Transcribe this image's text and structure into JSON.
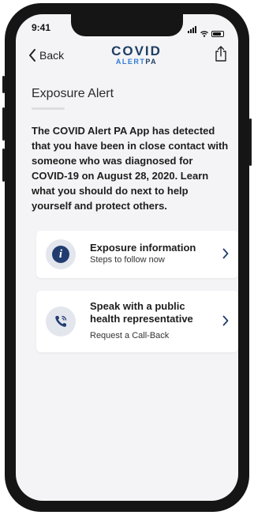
{
  "status_bar": {
    "time": "9:41"
  },
  "nav": {
    "back_label": "Back",
    "logo_top": "COVID",
    "logo_bottom_prefix": "ALERT",
    "logo_bottom_suffix": "PA"
  },
  "main": {
    "title": "Exposure Alert",
    "body": "The COVID Alert PA App has detected that you have been in close contact with someone who was diagnosed for COVID-19 on August 28, 2020. Learn what you should do next to help yourself and protect others.",
    "cards": [
      {
        "title": "Exposure information",
        "subtitle": "Steps to follow now",
        "icon": "info-icon"
      },
      {
        "title": "Speak with a public health representative",
        "subtitle": "Request  a Call-Back",
        "icon": "phone-icon"
      }
    ]
  },
  "colors": {
    "brand_navy": "#213d70",
    "screen_bg": "#f4f4f6",
    "icon_bg": "#e4e6ee"
  }
}
